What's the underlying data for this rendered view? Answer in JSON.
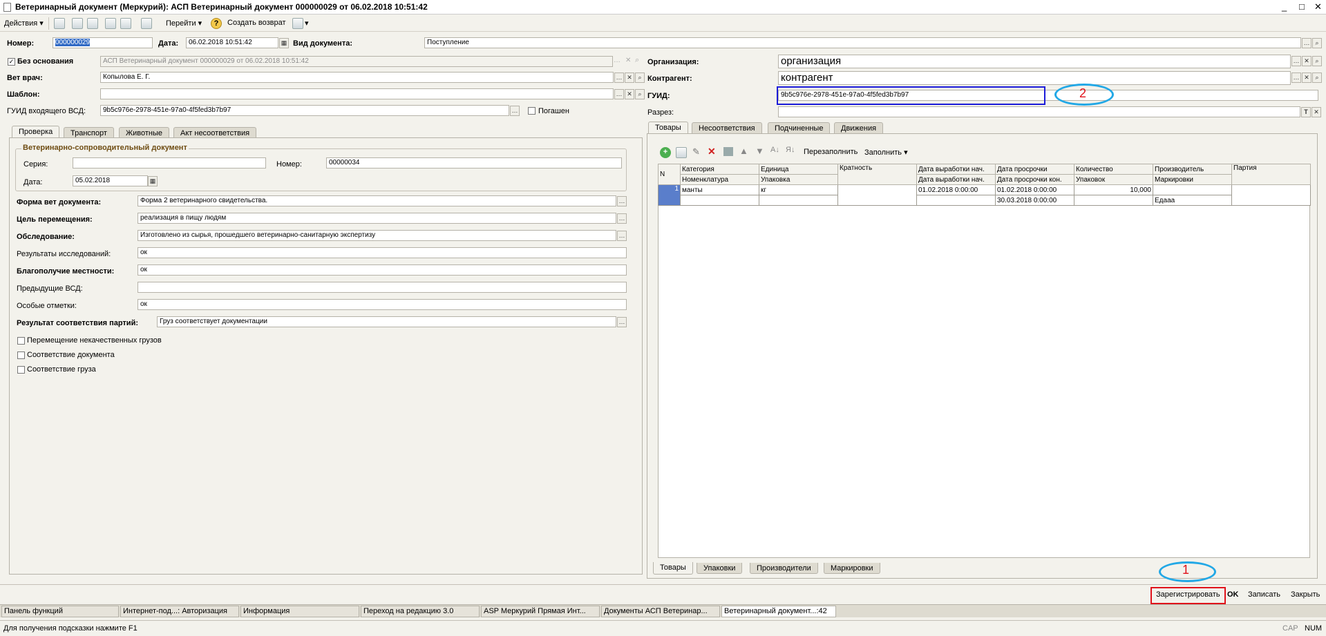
{
  "window": {
    "title": "Ветеринарный документ (Меркурий): АСП Ветеринарный документ 000000029 от 06.02.2018 10:51:42",
    "controls": [
      "_",
      "□",
      "✕"
    ]
  },
  "toolbar": {
    "actions": "Действия",
    "goto": "Перейти",
    "help": "?",
    "create_return": "Создать возврат"
  },
  "header": {
    "number_label": "Номер:",
    "number_value": "000000029",
    "date_label": "Дата:",
    "date_value": "06.02.2018 10:51:42",
    "doctype_label": "Вид документа:",
    "doctype_value": "Поступление",
    "no_basis_label": "Без основания",
    "no_basis_checked": true,
    "basis_value": "АСП Ветеринарный документ 000000029 от 06.02.2018 10:51:42",
    "vet_label": "Вет врач:",
    "vet_value": "Копылова Е. Г.",
    "template_label": "Шаблон:",
    "template_value": "",
    "guid_in_label": "ГУИД входящего ВСД:",
    "guid_in_value": "9b5c976e-2978-451e-97a0-4f5fed3b7b97",
    "repaid_label": "Погашен",
    "repaid_checked": false,
    "org_label": "Организация:",
    "org_value": "организация",
    "contractor_label": "Контрагент:",
    "contractor_value": "контрагент",
    "guid_label": "ГУИД:",
    "guid_value": "9b5c976e-2978-451e-97a0-4f5fed3b7b97",
    "section_label": "Разрез:",
    "section_value": ""
  },
  "left_tabs": [
    "Проверка",
    "Транспорт",
    "Животные",
    "Акт несоответствия"
  ],
  "check": {
    "group_title": "Ветеринарно-сопроводительный документ",
    "series_label": "Серия:",
    "series_value": "",
    "number_label": "Номер:",
    "number_value": "00000034",
    "date_label": "Дата:",
    "date_value": "05.02.2018",
    "form_label": "Форма вет документа:",
    "form_value": "Форма 2 ветеринарного свидетельства.",
    "purpose_label": "Цель перемещения:",
    "purpose_value": "реализация в пищу людям",
    "inspection_label": "Обследование:",
    "inspection_value": "Изготовлено из сырья, прошедшего ветеринарно-санитарную экспертизу",
    "research_label": "Результаты исследований:",
    "research_value": "ок",
    "welfare_label": "Благополучие местности:",
    "welfare_value": "ок",
    "prev_label": "Предыдущие ВСД:",
    "prev_value": "",
    "special_label": "Особые отметки:",
    "special_value": "ок",
    "result_label": "Результат соответствия партий:",
    "result_value": "Груз соответствует документации",
    "cb1": "Перемещение некачественных грузов",
    "cb2": "Соответствие документа",
    "cb3": "Соответствие груза"
  },
  "right_tabs": [
    "Товары",
    "Несоответствия",
    "Подчиненные",
    "Движения"
  ],
  "goods_toolbar": {
    "refill": "Перезаполнить",
    "fill": "Заполнить"
  },
  "table": {
    "head1": [
      "N",
      "Категория",
      "Единица",
      "Кратность",
      "Дата выработки нач.",
      "Дата просрочки",
      "Количество",
      "Производитель",
      "Партия"
    ],
    "head2": [
      "Номенклатура",
      "Упаковка",
      "Дата выработки нач.",
      "Дата просрочки кон.",
      "Упаковок",
      "Маркировки"
    ],
    "row1": [
      "1",
      "манты",
      "кг",
      "",
      "01.02.2018 0:00:00",
      "01.02.2018 0:00:00",
      "10,000",
      "",
      ""
    ],
    "row2": [
      "",
      "",
      "",
      "",
      "",
      "30.03.2018 0:00:00",
      "",
      "Едааа",
      ""
    ]
  },
  "bottom_tabs": [
    "Товары",
    "Упаковки",
    "Производители",
    "Маркировки"
  ],
  "footer": {
    "register": "Зарегистрировать",
    "ok": "OK",
    "save": "Записать",
    "close": "Закрыть"
  },
  "annotations": {
    "n1": "1",
    "n2": "2"
  },
  "taskbar": [
    "Панель функций",
    "Интернет-под...: Авторизация",
    "Информация",
    "Переход на редакцию 3.0",
    "ASP Меркурий Прямая Инт...",
    "Документы АСП Ветеринар...",
    "Ветеринарный документ...:42"
  ],
  "status": {
    "hint": "Для получения подсказки нажмите F1",
    "cap": "CAP",
    "num": "NUM"
  }
}
